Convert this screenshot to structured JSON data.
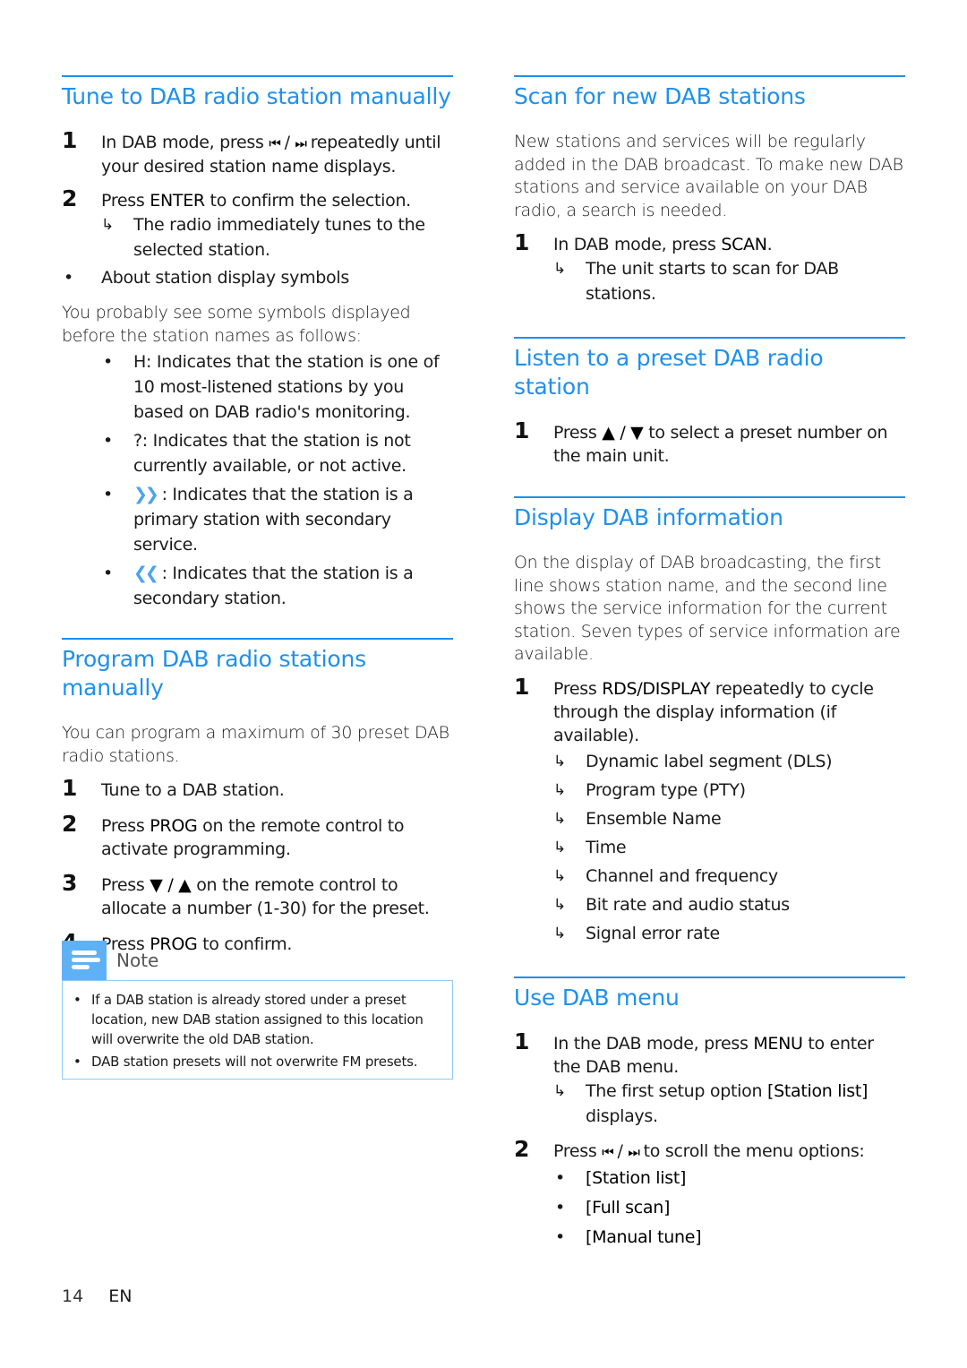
{
  "left_column": {
    "tune_manual": {
      "heading": "Tune to DAB radio station manually",
      "steps": [
        {
          "num": "1",
          "pre": "In DAB mode, press",
          "icon1": "⏮",
          "sep": " / ",
          "icon2": "⏭",
          "post": "repeatedly until your desired station name displays."
        },
        {
          "num": "2",
          "pre": "Press",
          "key": "ENTER",
          "post": "to confirm the selection.",
          "result": "The radio immediately tunes to the selected station."
        }
      ],
      "bullet": "About station display symbols",
      "intro": "You probably see some symbols displayed before the station names as follows:",
      "symbols": [
        {
          "symbol": "H",
          "text": ": Indicates that the station is one of 10 most-listened stations by you based on DAB radio's monitoring."
        },
        {
          "symbol": "?",
          "text": ": Indicates that the station is not currently available, or not active."
        },
        {
          "symbol": "»",
          "text": " : Indicates that the station is a primary station with secondary service."
        },
        {
          "symbol": "«",
          "text": " : Indicates that the station is a secondary station."
        }
      ]
    },
    "program_manual": {
      "heading": "Program DAB radio stations manually",
      "intro": "You can program a maximum of 30 preset DAB radio stations.",
      "steps": [
        {
          "num": "1",
          "text": "Tune to a DAB station."
        },
        {
          "num": "2",
          "pre": "Press",
          "key": "PROG",
          "post": "on the remote control to activate programming."
        },
        {
          "num": "3",
          "pre": "Press",
          "key": "▼ / ▲",
          "post": "on the remote control to allocate a number (1-30) for the preset."
        },
        {
          "num": "4",
          "pre": "Press",
          "key": "PROG",
          "post": "to confirm."
        }
      ]
    },
    "note": {
      "title": "Note",
      "items": [
        "If a DAB station is already stored under a preset location, new DAB station assigned to this location will overwrite the old DAB station.",
        "DAB station presets will not overwrite FM presets."
      ]
    }
  },
  "right_column": {
    "scan": {
      "heading": "Scan for new DAB stations",
      "intro": "New stations and services will be regularly added in the DAB broadcast. To make new DAB stations and service available on your DAB radio, a search is needed.",
      "steps": [
        {
          "num": "1",
          "pre": "In DAB mode, press",
          "key": "SCAN",
          "post": ".",
          "result": "The unit starts to scan for DAB stations."
        }
      ]
    },
    "listen_preset": {
      "heading": "Listen to a preset DAB radio station",
      "steps": [
        {
          "num": "1",
          "pre": "Press",
          "key": "▲ / ▼",
          "post": "to select a preset number on the main unit."
        }
      ]
    },
    "display_info": {
      "heading": "Display DAB information",
      "intro": "On the display of DAB broadcasting, the first line shows station name, and the second line shows the service information for the current station. Seven types of service information are available.",
      "steps": [
        {
          "num": "1",
          "pre": "Press",
          "key": "RDS/DISPLAY",
          "post": "repeatedly to cycle through the display information (if available)."
        }
      ],
      "results": [
        "Dynamic label segment (DLS)",
        "Program type (PTY)",
        "Ensemble Name",
        "Time",
        "Channel and frequency",
        "Bit rate and audio status",
        "Signal error rate"
      ]
    },
    "dab_menu": {
      "heading": "Use DAB menu",
      "steps": [
        {
          "num": "1",
          "pre": "In the DAB mode, press",
          "key": "MENU",
          "post": "to enter the DAB menu.",
          "result_pre": "The first setup option",
          "result_key": "[Station list]",
          "result_post": "displays."
        },
        {
          "num": "2",
          "pre": "Press",
          "icon1": "⏮",
          "sep": " / ",
          "icon2": "⏭",
          "post": "to scroll the menu options:"
        }
      ],
      "options": [
        "[Station list]",
        "[Full scan]",
        "[Manual tune]"
      ]
    }
  },
  "footer": {
    "page_number": "14",
    "language": "EN"
  },
  "glyphs": {
    "result_arrow": "↳",
    "bullet": "•"
  }
}
